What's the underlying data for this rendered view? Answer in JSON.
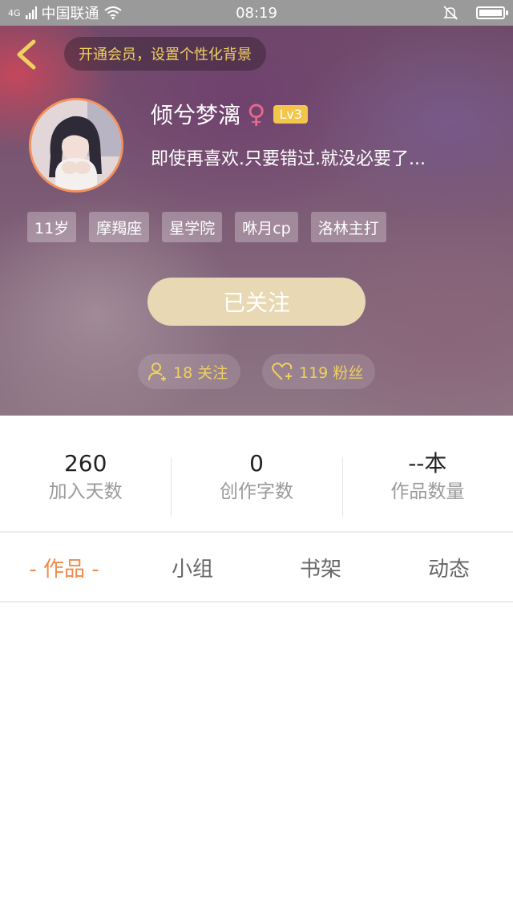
{
  "status_bar": {
    "network": "4G",
    "carrier": "中国联通",
    "time": "08:19"
  },
  "header": {
    "vip_banner": "开通会员，设置个性化背景"
  },
  "profile": {
    "name": "倾兮梦漓",
    "gender_symbol": "♀",
    "level": "Lv3",
    "bio": "即使再喜欢.只要错过.就没必要了...",
    "tags": [
      "11岁",
      "摩羯座",
      "星学院",
      "咻月cp",
      "洛林主打"
    ],
    "follow_button": "已关注",
    "following": "18 关注",
    "fans": "119 粉丝"
  },
  "stats": [
    {
      "value": "260",
      "label": "加入天数"
    },
    {
      "value": "0",
      "label": "创作字数"
    },
    {
      "value": "--本",
      "label": "作品数量"
    }
  ],
  "tabs": [
    {
      "label": "- 作品 -"
    },
    {
      "label": "小组"
    },
    {
      "label": "书架"
    },
    {
      "label": "动态"
    }
  ],
  "colors": {
    "accent_orange": "#f08a4b",
    "gold_text": "#f0d060",
    "follow_button_bg": "#e8d8b3",
    "level_badge": "#f3c64b",
    "gender_pink": "#e86a8a"
  },
  "icons": [
    "back-icon",
    "wifi-icon",
    "bell-off-icon",
    "battery-icon",
    "add-user-icon",
    "heart-plus-icon"
  ]
}
